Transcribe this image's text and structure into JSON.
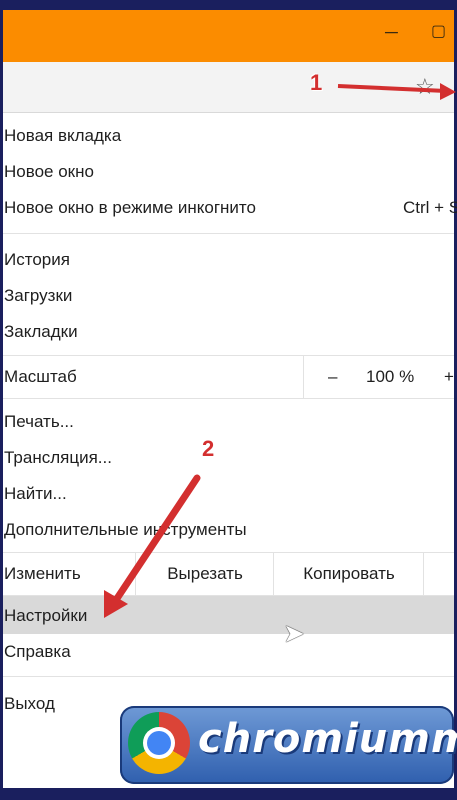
{
  "window": {
    "minimize_glyph": "─",
    "restore_glyph": "▢",
    "star_glyph": "☆"
  },
  "annotations": {
    "badge1": "1",
    "badge2": "2",
    "arrow_color": "#d32f2f"
  },
  "menu": {
    "new_tab": "Новая вкладка",
    "new_window": "Новое окно",
    "incognito": "Новое окно в режиме инкогнито",
    "incognito_shortcut": "Ctrl + S",
    "history": "История",
    "downloads": "Загрузки",
    "bookmarks": "Закладки",
    "zoom_label": "Масштаб",
    "zoom_minus": "–",
    "zoom_value": "100 %",
    "zoom_plus": "+",
    "print": "Печать...",
    "cast": "Трансляция...",
    "find": "Найти...",
    "more_tools": "Дополнительные инструменты",
    "edit_label": "Изменить",
    "cut": "Вырезать",
    "copy": "Копировать",
    "settings": "Настройки",
    "help": "Справка",
    "exit": "Выход"
  },
  "watermark": {
    "text": "chromiumm",
    "colors": {
      "red": "#db4437",
      "yellow": "#f4b400",
      "green": "#0f9d58",
      "blue": "#4285f4"
    }
  },
  "theme": {
    "titlebar": "#fb8c00",
    "frame": "#1a1f5e",
    "highlight": "#d9d9d9"
  }
}
